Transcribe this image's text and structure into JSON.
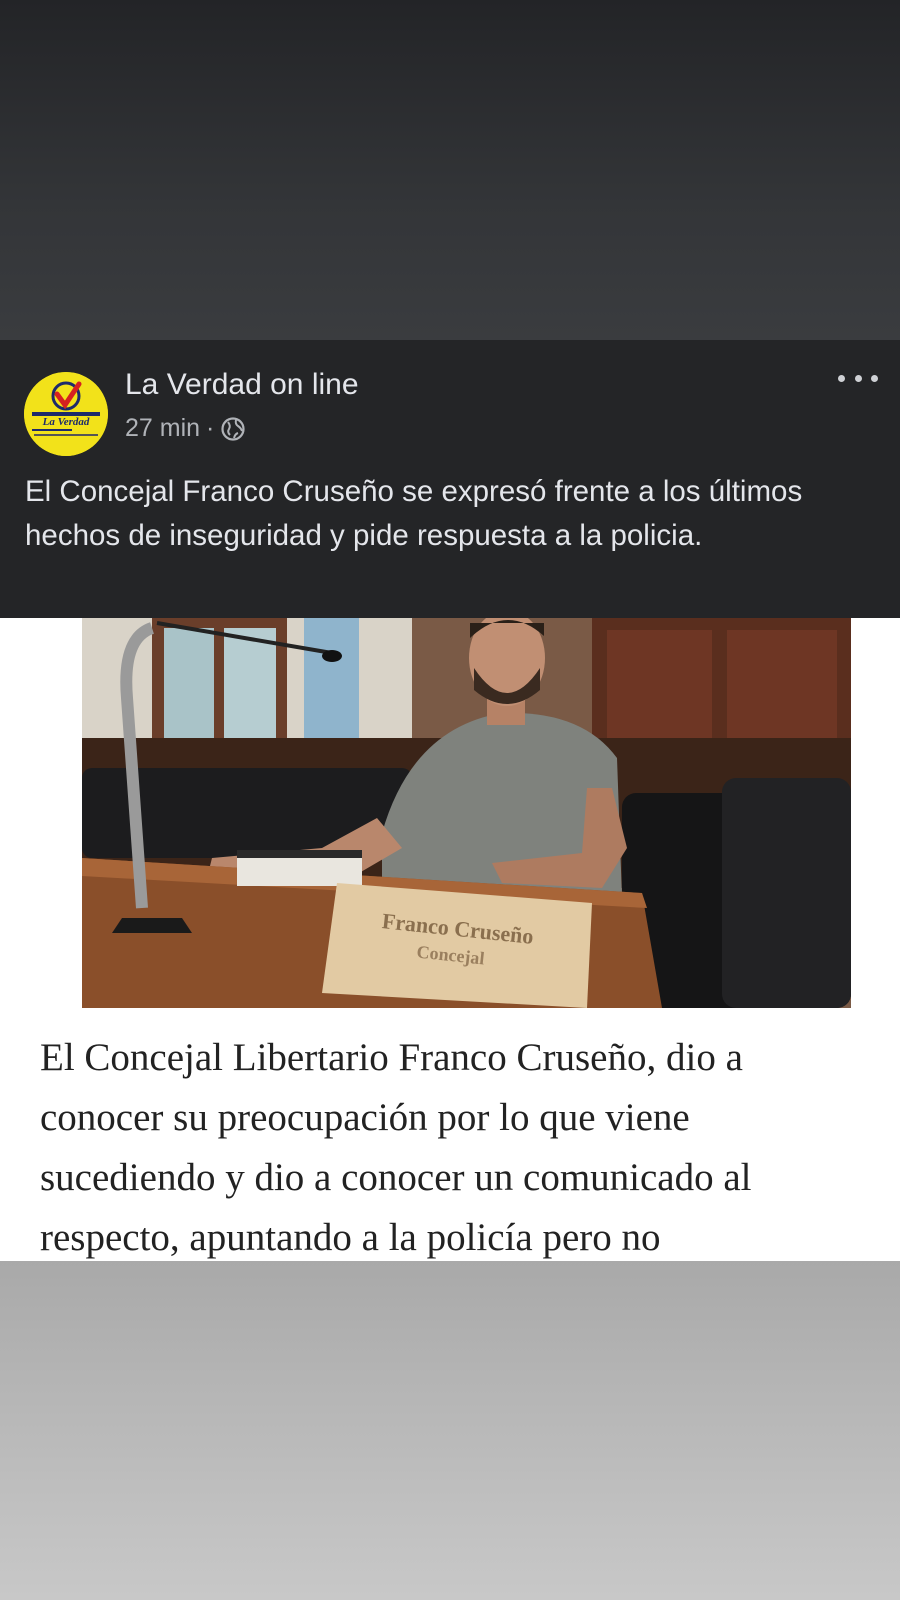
{
  "post": {
    "author": "La Verdad on line",
    "time": "27 min",
    "separator": "·",
    "text": "El Concejal Franco Cruseño se expresó frente a los últimos hechos de inseguridad y pide respuesta a la policia.",
    "avatar_brand": "La Verdad",
    "more_icon": "more-horizontal-icon",
    "privacy_icon": "globe-icon"
  },
  "article": {
    "nameplate_line1": "Franco Cruseño",
    "nameplate_line2": "Concejal",
    "text": "El Concejal Libertario Franco Cruseño, dio a conocer su preocupación por lo que viene sucediendo y dio a conocer un comunicado al respecto, apuntando a la policía pero no"
  },
  "colors": {
    "post_bg": "#242527",
    "avatar_bg": "#f2e21a",
    "text_primary": "#e4e6eb",
    "text_secondary": "#b0b3b8"
  }
}
